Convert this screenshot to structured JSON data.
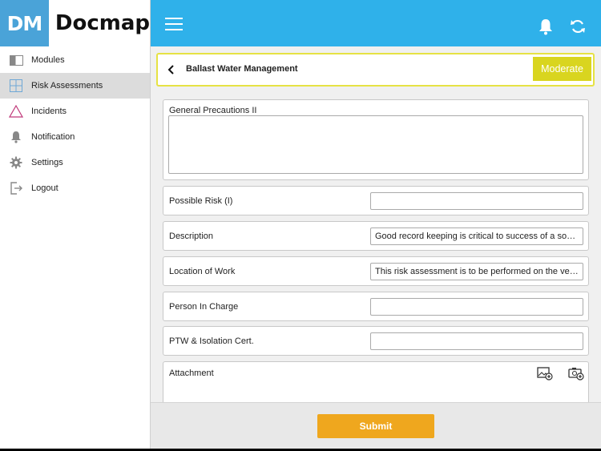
{
  "app": {
    "logo_badge": "DM",
    "logo_text": "Docmap"
  },
  "sidebar": {
    "items": [
      {
        "label": "Modules",
        "icon": "modules-icon"
      },
      {
        "label": "Risk Assessments",
        "icon": "grid-icon",
        "active": true
      },
      {
        "label": "Incidents",
        "icon": "warning-triangle-icon"
      },
      {
        "label": "Notification",
        "icon": "bell-icon"
      },
      {
        "label": "Settings",
        "icon": "gear-icon"
      },
      {
        "label": "Logout",
        "icon": "logout-icon"
      }
    ]
  },
  "header": {
    "accent": "#2fb1ea"
  },
  "form": {
    "title": "Ballast Water Management",
    "risk_level": "Moderate",
    "risk_color": "#d9d51f",
    "general_precautions": {
      "label": "General Precautions II",
      "value": ""
    },
    "possible_risk": {
      "label": "Possible Risk (I)",
      "value": ""
    },
    "description": {
      "label": "Description",
      "value": "Good record keeping is critical to success of a soun..."
    },
    "location": {
      "label": "Location of Work",
      "value": "This risk assessment is to be performed on the vessel"
    },
    "person_in_charge": {
      "label": "Person In Charge",
      "value": ""
    },
    "ptw": {
      "label": "PTW & Isolation Cert.",
      "value": ""
    },
    "attachment": {
      "label": "Attachment"
    }
  },
  "footer": {
    "submit_label": "Submit",
    "submit_color": "#efa71e"
  }
}
